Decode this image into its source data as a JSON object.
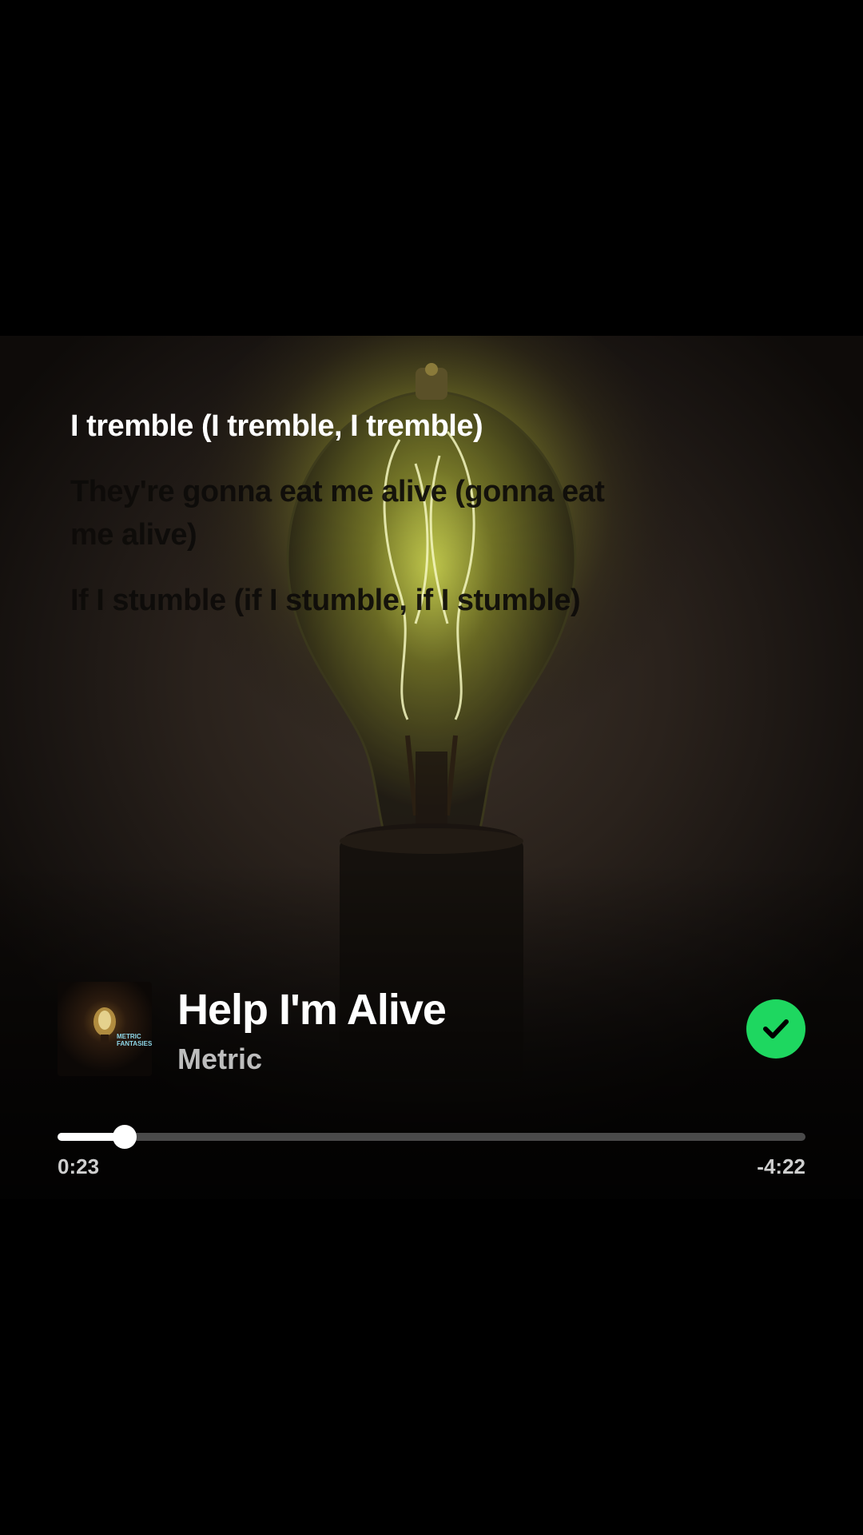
{
  "lyrics": {
    "lines": [
      {
        "text": "I tremble (I tremble, I tremble)",
        "state": "active"
      },
      {
        "text": "They're gonna eat me alive (gonna eat me alive)",
        "state": "upcoming"
      },
      {
        "text": "If I stumble (if I stumble, if I stumble)",
        "state": "upcoming"
      }
    ]
  },
  "track": {
    "title": "Help I'm Alive",
    "artist": "Metric",
    "cover_text": "METRIC\nFANTASIES",
    "liked": true,
    "liked_color": "#1ed760"
  },
  "playback": {
    "elapsed": "0:23",
    "remaining": "-4:22",
    "progress_fraction": 0.09
  }
}
